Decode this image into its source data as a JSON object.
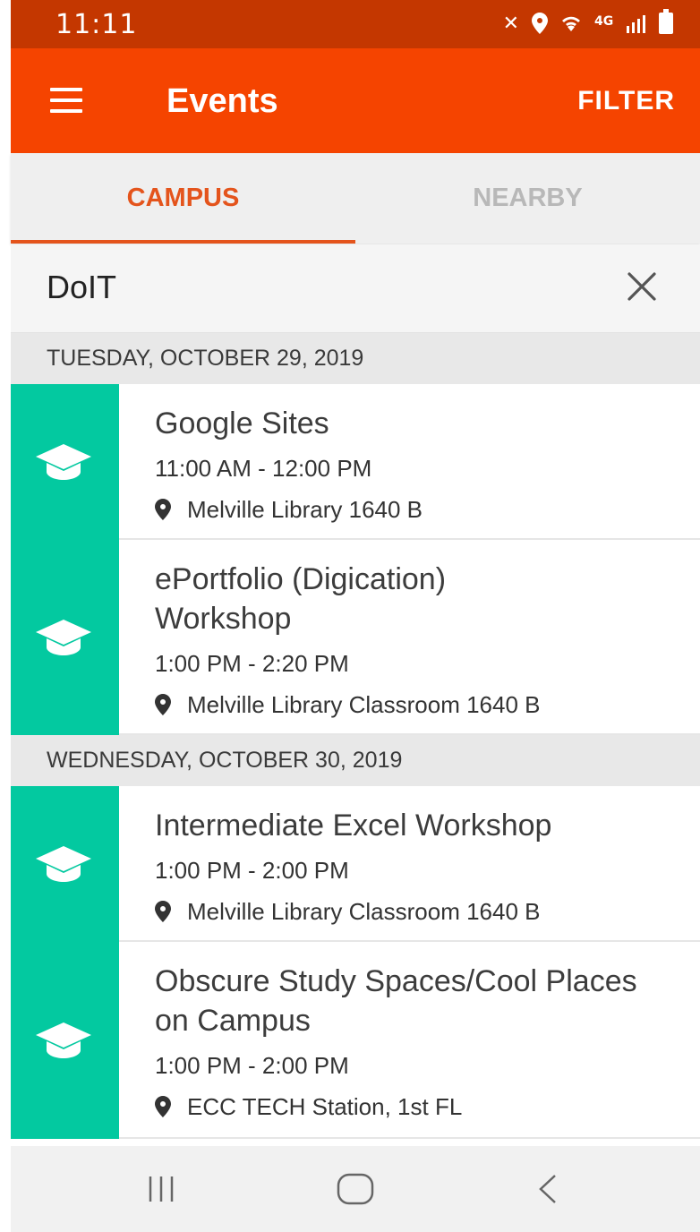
{
  "status_bar": {
    "time": "11:11"
  },
  "app_bar": {
    "title": "Events",
    "filter_label": "FILTER"
  },
  "tabs": [
    {
      "label": "CAMPUS",
      "active": true
    },
    {
      "label": "NEARBY",
      "active": false
    }
  ],
  "search": {
    "value": "DoIT"
  },
  "days": [
    {
      "date": "TUESDAY, OCTOBER 29, 2019",
      "events": [
        {
          "name": "Google Sites",
          "time": "11:00 AM - 12:00 PM",
          "location": "Melville Library 1640 B"
        },
        {
          "name": "ePortfolio (Digication) Workshop",
          "time": "1:00 PM - 2:20 PM",
          "location": "Melville Library Classroom 1640 B"
        }
      ]
    },
    {
      "date": "WEDNESDAY, OCTOBER 30, 2019",
      "events": [
        {
          "name": "Intermediate Excel Workshop",
          "time": "1:00 PM - 2:00 PM",
          "location": "Melville Library Classroom 1640 B"
        },
        {
          "name": "Obscure Study Spaces/Cool Places on Campus",
          "time": "1:00 PM - 2:00 PM",
          "location": "ECC TECH Station, 1st FL"
        }
      ]
    }
  ],
  "colors": {
    "app_bar": "#f54400",
    "status_bar": "#c43700",
    "accent": "#e4541c",
    "event_stripe": "#03c9a0"
  },
  "icons": {
    "menu": "hamburger-menu-icon",
    "clear": "close-icon",
    "event": "graduation-cap-icon",
    "location": "map-pin-icon"
  }
}
